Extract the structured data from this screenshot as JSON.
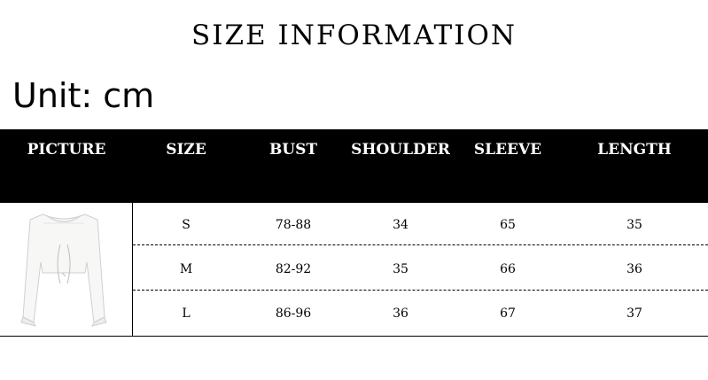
{
  "title": "SIZE INFORMATION",
  "unit_label": "Unit: cm",
  "table": {
    "headers": [
      "PICTURE",
      "SIZE",
      "BUST",
      "SHOULDER",
      "SLEEVE",
      "LENGTH"
    ],
    "rows": [
      {
        "size": "S",
        "bust": "78-88",
        "shoulder": "34",
        "sleeve": "65",
        "length": "35"
      },
      {
        "size": "M",
        "bust": "82-92",
        "shoulder": "35",
        "sleeve": "66",
        "length": "36"
      },
      {
        "size": "L",
        "bust": "86-96",
        "shoulder": "36",
        "sleeve": "67",
        "length": "37"
      }
    ]
  },
  "picture": {
    "icon": "white-crop-top-image"
  },
  "colors": {
    "header_bg": "#000000",
    "header_text": "#ffffff",
    "text": "#000000",
    "background": "#ffffff"
  }
}
